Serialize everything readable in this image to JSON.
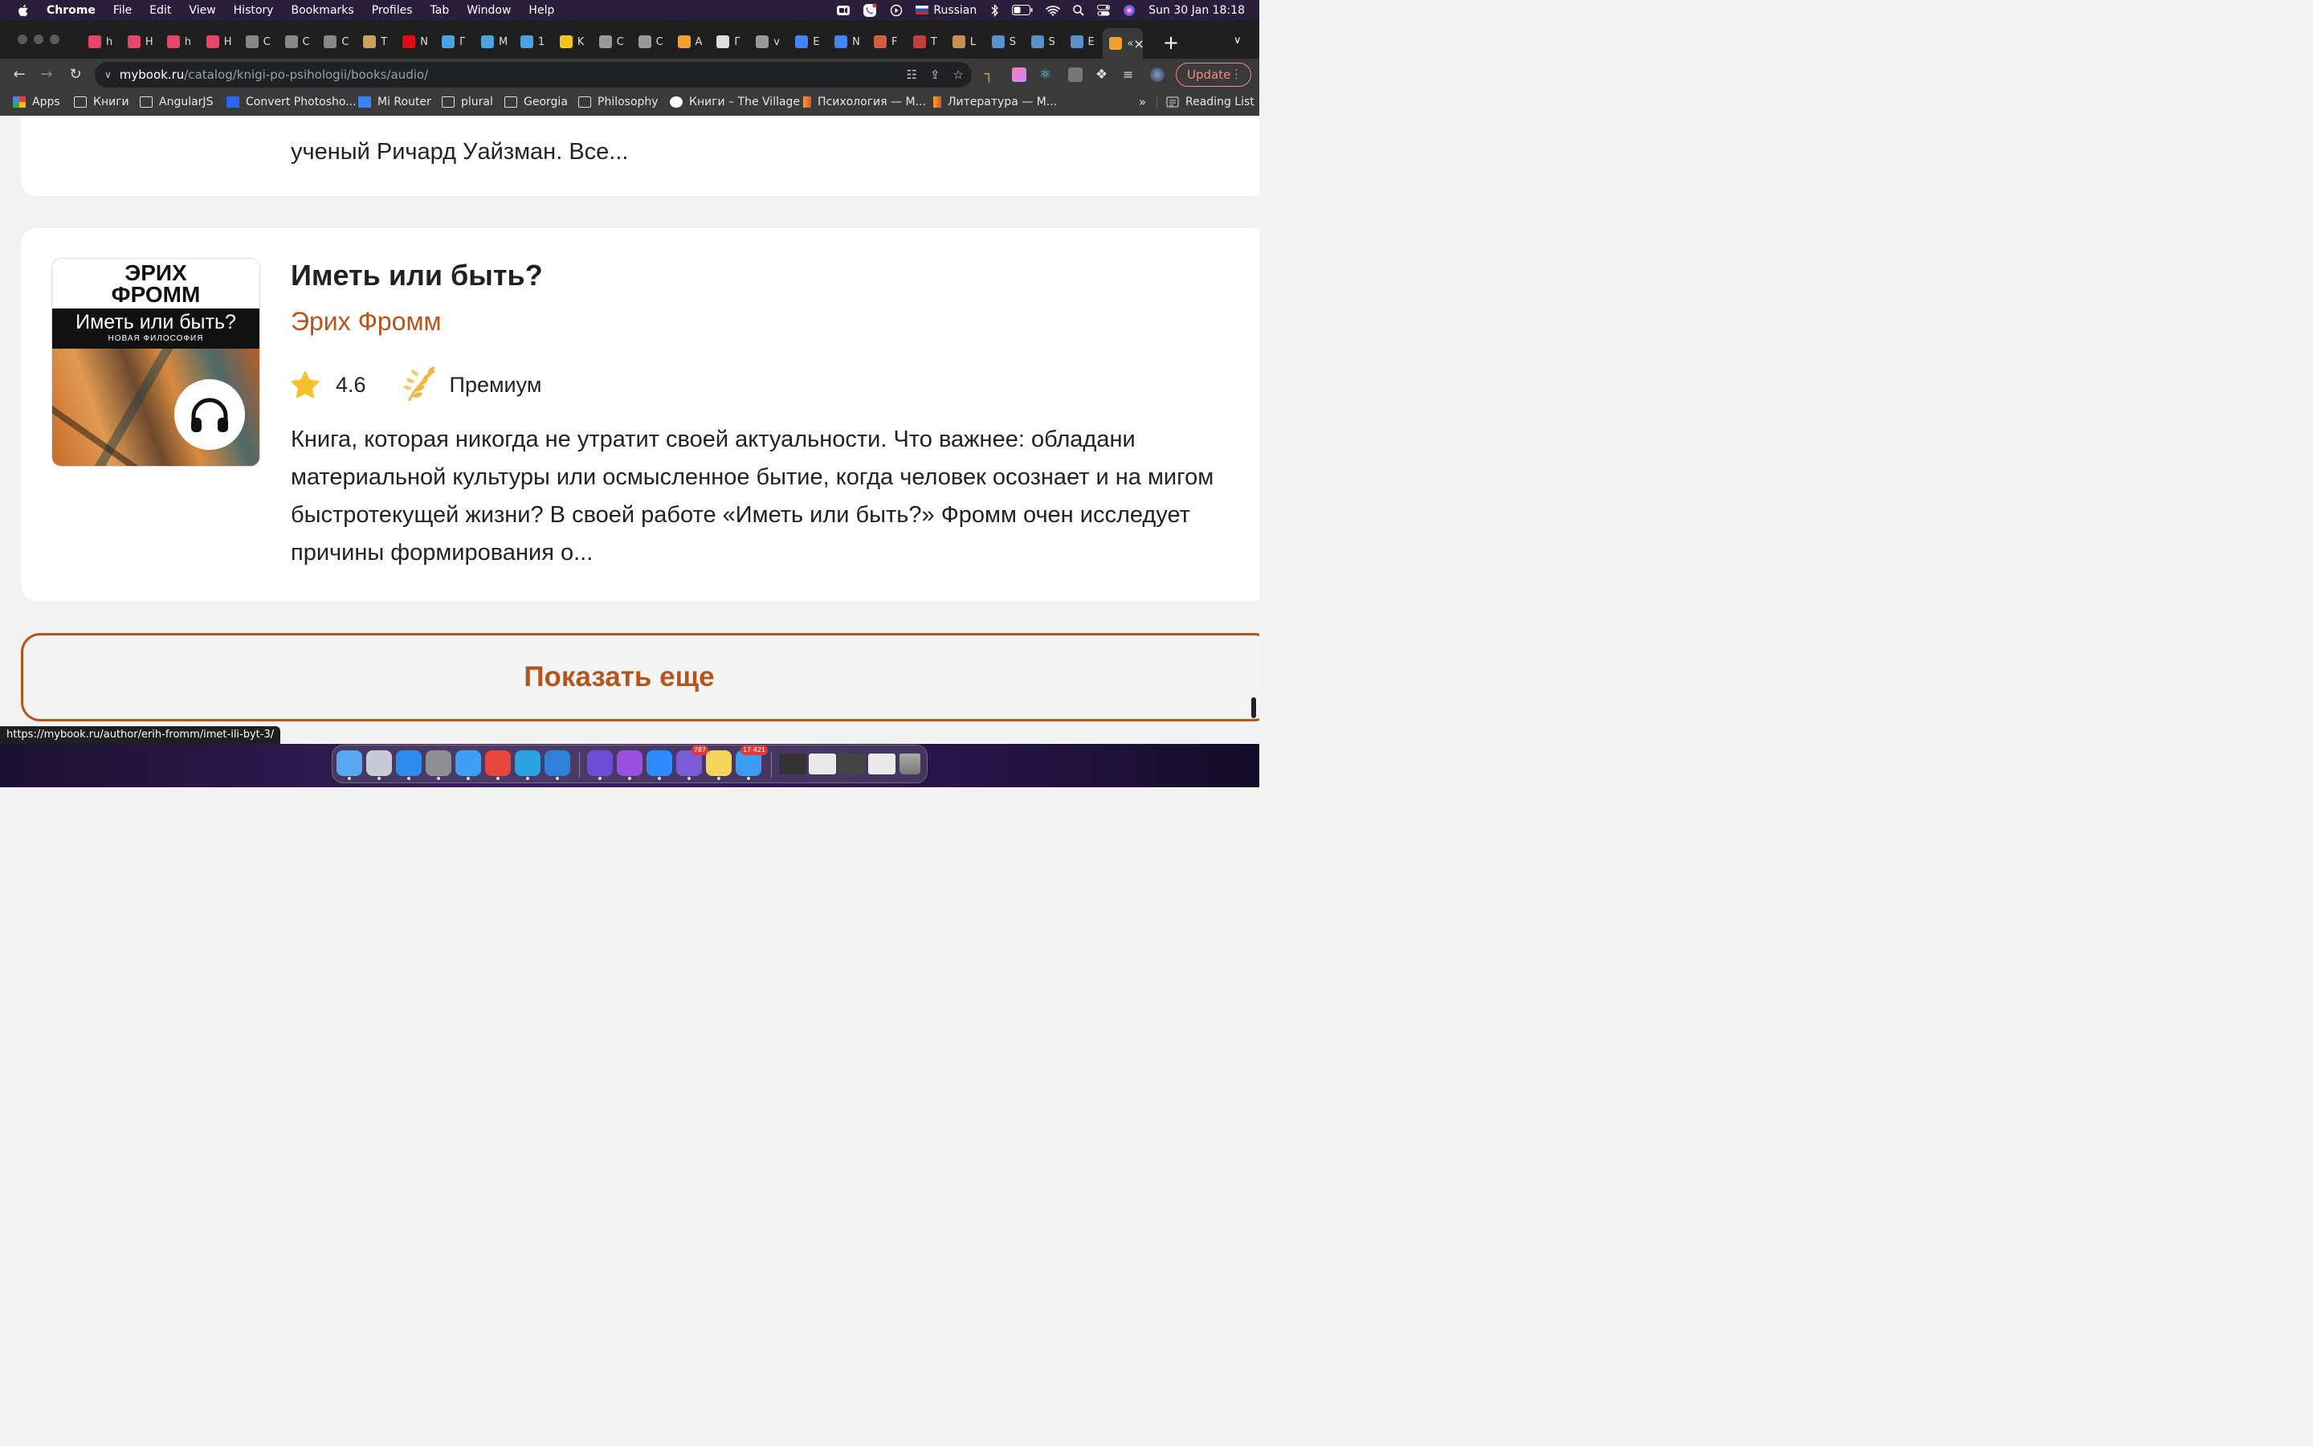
{
  "menubar": {
    "app_name": "Chrome",
    "menus": [
      "File",
      "Edit",
      "View",
      "History",
      "Bookmarks",
      "Profiles",
      "Tab",
      "Window",
      "Help"
    ],
    "input_language": "Russian",
    "clock": "Sun 30 Jan  18:18"
  },
  "tabs": [
    {
      "label": "h",
      "icon": "video-play-icon",
      "color": "#e8456b"
    },
    {
      "label": "H",
      "icon": "video-play-icon",
      "color": "#e8456b"
    },
    {
      "label": "h",
      "icon": "video-play-icon",
      "color": "#e8456b"
    },
    {
      "label": "H",
      "icon": "video-play-icon",
      "color": "#e8456b"
    },
    {
      "label": "C",
      "icon": "hd-icon",
      "color": "#888888"
    },
    {
      "label": "C",
      "icon": "hd-icon",
      "color": "#888888"
    },
    {
      "label": "C",
      "icon": "hd-icon",
      "color": "#888888"
    },
    {
      "label": "T",
      "icon": "ship-icon",
      "color": "#c8a060"
    },
    {
      "label": "N",
      "icon": "netflix-icon",
      "color": "#e50914"
    },
    {
      "label": "Г",
      "icon": "book-icon",
      "color": "#4aa3df"
    },
    {
      "label": "M",
      "icon": "book-icon",
      "color": "#4aa3df"
    },
    {
      "label": "1",
      "icon": "book-icon",
      "color": "#4aa3df"
    },
    {
      "label": "K",
      "icon": "trident-icon",
      "color": "#f0c419"
    },
    {
      "label": "C",
      "icon": "globe-icon",
      "color": "#999999"
    },
    {
      "label": "C",
      "icon": "globe-icon",
      "color": "#999999"
    },
    {
      "label": "A",
      "icon": "mybook-icon",
      "color": "#f0a030"
    },
    {
      "label": "Г",
      "icon": "speaker-icon",
      "color": "#dddddd"
    },
    {
      "label": "v",
      "icon": "globe-icon",
      "color": "#999999"
    },
    {
      "label": "E",
      "icon": "google-icon",
      "color": "#4285f4"
    },
    {
      "label": "N",
      "icon": "google-icon",
      "color": "#4285f4"
    },
    {
      "label": "F",
      "icon": "books-icon",
      "color": "#d06040"
    },
    {
      "label": "T",
      "icon": "star-icon",
      "color": "#c04040"
    },
    {
      "label": "L",
      "icon": "hex-icon",
      "color": "#c89050"
    },
    {
      "label": "S",
      "icon": "steam-icon",
      "color": "#5a8fc8"
    },
    {
      "label": "S",
      "icon": "steam-icon",
      "color": "#5a8fc8"
    },
    {
      "label": "E",
      "icon": "steam-icon",
      "color": "#5a8fc8"
    },
    {
      "label": "«",
      "icon": "mybook-icon",
      "color": "#f0a030",
      "active": true
    }
  ],
  "toolbar": {
    "url_host": "mybook.ru",
    "url_path": "/catalog/knigi-po-psihologii/books/audio/",
    "update_label": "Update"
  },
  "bookmarks": [
    {
      "label": "Apps",
      "icon": "apps-grid-icon"
    },
    {
      "label": "Книги",
      "icon": "folder-icon"
    },
    {
      "label": "AngularJS",
      "icon": "folder-icon"
    },
    {
      "label": "Convert Photosho...",
      "icon": "css3-icon"
    },
    {
      "label": "Mi Router",
      "icon": "wifi-icon"
    },
    {
      "label": "plural",
      "icon": "folder-icon"
    },
    {
      "label": "Georgia",
      "icon": "folder-icon"
    },
    {
      "label": "Philosophy",
      "icon": "folder-icon"
    },
    {
      "label": "Книги – The Village",
      "icon": "village-icon"
    },
    {
      "label": "Психология — M...",
      "icon": "mybook-icon"
    },
    {
      "label": "Литература — M...",
      "icon": "mybook-icon"
    }
  ],
  "bookmarks_more": "»",
  "reading_list": "Reading List",
  "prev_card": {
    "desc_tail": "ученый Ричард Уайзман. Все..."
  },
  "book": {
    "cover_author": "ЭРИХ\nФРОММ",
    "cover_title": "Иметь или быть?",
    "cover_subtitle": "НОВАЯ ФИЛОСОФИЯ",
    "title": "Иметь или быть?",
    "author": "Эрих Фромм",
    "rating": "4.6",
    "badge": "Премиум",
    "description": "Книга, которая никогда не утратит своей актуальности. Что важнее: обладани материальной культуры или осмысленное бытие, когда человек осознает и на мигом быстротекущей жизни? В своей работе «Иметь или быть?» Фромм очен исследует причины формирования о..."
  },
  "show_more_label": "Показать еще",
  "status_url": "https://mybook.ru/author/erih-fromm/imet-ili-byt-3/",
  "dock": {
    "apps": [
      {
        "name": "finder-icon",
        "color": "#5aa7ef"
      },
      {
        "name": "launchpad-icon",
        "color": "#c9c9d6"
      },
      {
        "name": "app-store-icon",
        "color": "#2e8cf0"
      },
      {
        "name": "system-preferences-icon",
        "color": "#8e8e93"
      },
      {
        "name": "safari-icon",
        "color": "#3ea0f5"
      },
      {
        "name": "chrome-icon",
        "color": "#e8453c"
      },
      {
        "name": "telegram-icon",
        "color": "#2aa3e0"
      },
      {
        "name": "vscode-icon",
        "color": "#2f80d8"
      },
      {
        "name": "imovie-icon",
        "color": "#6a4fd6"
      },
      {
        "name": "podcasts-icon",
        "color": "#9b4fe0"
      },
      {
        "name": "zoom-icon",
        "color": "#2d8cff"
      },
      {
        "name": "viber-icon",
        "color": "#7b5cd6",
        "badge": "787"
      },
      {
        "name": "notes-icon",
        "color": "#f5d45a"
      },
      {
        "name": "mail-icon",
        "color": "#3e9cf0",
        "badge": "17 421"
      }
    ]
  }
}
